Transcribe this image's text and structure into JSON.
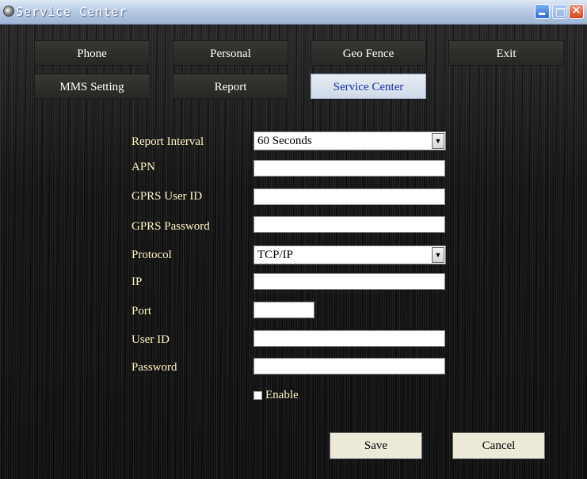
{
  "window": {
    "title": "Service Center"
  },
  "tabs": [
    {
      "label": "Phone",
      "active": false
    },
    {
      "label": "Personal",
      "active": false
    },
    {
      "label": "Geo Fence",
      "active": false
    },
    {
      "label": "Exit",
      "active": false
    },
    {
      "label": "MMS Setting",
      "active": false
    },
    {
      "label": "Report",
      "active": false
    },
    {
      "label": "Service Center",
      "active": true
    }
  ],
  "form": {
    "report_interval": {
      "label": "Report Interval",
      "value": "60 Seconds"
    },
    "apn": {
      "label": "APN",
      "value": ""
    },
    "gprs_user_id": {
      "label": "GPRS User ID",
      "value": ""
    },
    "gprs_password": {
      "label": "GPRS Password",
      "value": ""
    },
    "protocol": {
      "label": "Protocol",
      "value": "TCP/IP"
    },
    "ip": {
      "label": "IP",
      "value": ""
    },
    "port": {
      "label": "Port",
      "value": ""
    },
    "user_id": {
      "label": "User ID",
      "value": ""
    },
    "password": {
      "label": "Password",
      "value": ""
    },
    "enable": {
      "label": "Enable",
      "checked": false
    }
  },
  "actions": {
    "save_label": "Save",
    "cancel_label": "Cancel"
  },
  "colors": {
    "label_text": "#fff3c6",
    "active_tab_text": "#1530a0",
    "close_button": "#d8421e"
  }
}
